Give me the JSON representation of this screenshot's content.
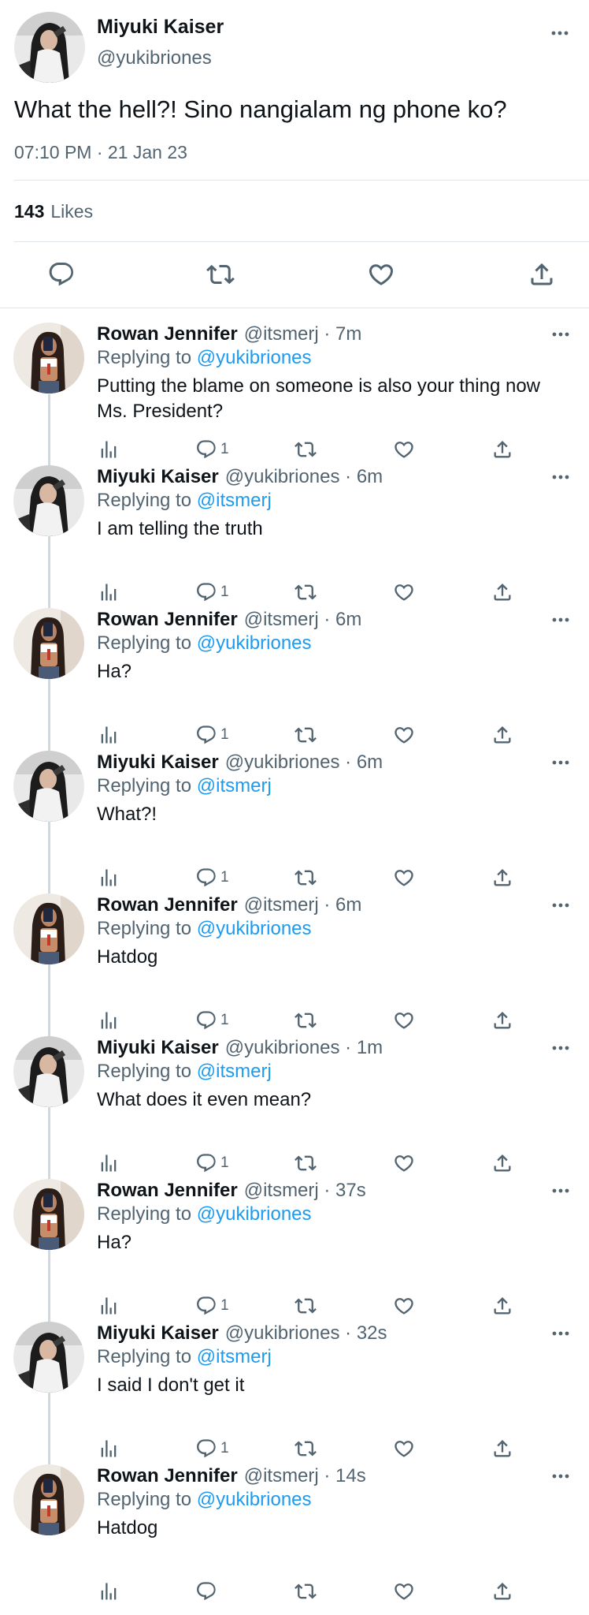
{
  "main_tweet": {
    "name": "Miyuki Kaiser",
    "handle": "@yukibriones",
    "text": "What the hell?! Sino nangialam ng phone ko?",
    "timestamp": "07:10 PM · 21 Jan 23",
    "likes_count": "143",
    "likes_label": "Likes"
  },
  "replies": [
    {
      "name": "Rowan Jennifer",
      "meta": "@itsmerj · 7m",
      "replying_label": "Replying to",
      "replying_to": "@yukibriones",
      "text": "Putting the blame on someone is also your thing now Ms. President?",
      "reply_count": "1",
      "avatar": "rowan"
    },
    {
      "name": "Miyuki Kaiser",
      "meta": "@yukibriones · 6m",
      "replying_label": "Replying to",
      "replying_to": "@itsmerj",
      "text": "I am telling the truth",
      "reply_count": "1",
      "avatar": "miyuki"
    },
    {
      "name": "Rowan Jennifer",
      "meta": "@itsmerj · 6m",
      "replying_label": "Replying to",
      "replying_to": "@yukibriones",
      "text": "Ha?",
      "reply_count": "1",
      "avatar": "rowan"
    },
    {
      "name": "Miyuki Kaiser",
      "meta": "@yukibriones · 6m",
      "replying_label": "Replying to",
      "replying_to": "@itsmerj",
      "text": "What?!",
      "reply_count": "1",
      "avatar": "miyuki"
    },
    {
      "name": "Rowan Jennifer",
      "meta": "@itsmerj · 6m",
      "replying_label": "Replying to",
      "replying_to": "@yukibriones",
      "text": "Hatdog",
      "reply_count": "1",
      "avatar": "rowan"
    },
    {
      "name": "Miyuki Kaiser",
      "meta": "@yukibriones · 1m",
      "replying_label": "Replying to",
      "replying_to": "@itsmerj",
      "text": "What does it even mean?",
      "reply_count": "1",
      "avatar": "miyuki"
    },
    {
      "name": "Rowan Jennifer",
      "meta": "@itsmerj · 37s",
      "replying_label": "Replying to",
      "replying_to": "@yukibriones",
      "text": "Ha?",
      "reply_count": "1",
      "avatar": "rowan"
    },
    {
      "name": "Miyuki Kaiser",
      "meta": "@yukibriones · 32s",
      "replying_label": "Replying to",
      "replying_to": "@itsmerj",
      "text": "I said I don't get it",
      "reply_count": "1",
      "avatar": "miyuki"
    },
    {
      "name": "Rowan Jennifer",
      "meta": "@itsmerj · 14s",
      "replying_label": "Replying to",
      "replying_to": "@yukibriones",
      "text": "Hatdog",
      "reply_count": "",
      "avatar": "rowan"
    }
  ],
  "icons": {
    "more": "more-icon",
    "reply": "reply-icon",
    "retweet": "retweet-icon",
    "like": "like-icon",
    "share": "share-icon",
    "views": "views-icon"
  },
  "colors": {
    "link": "#1d9bf0",
    "secondary": "#536471",
    "text": "#0f1419",
    "divider": "#e1e6ea",
    "thread_line": "#cfd9de"
  }
}
